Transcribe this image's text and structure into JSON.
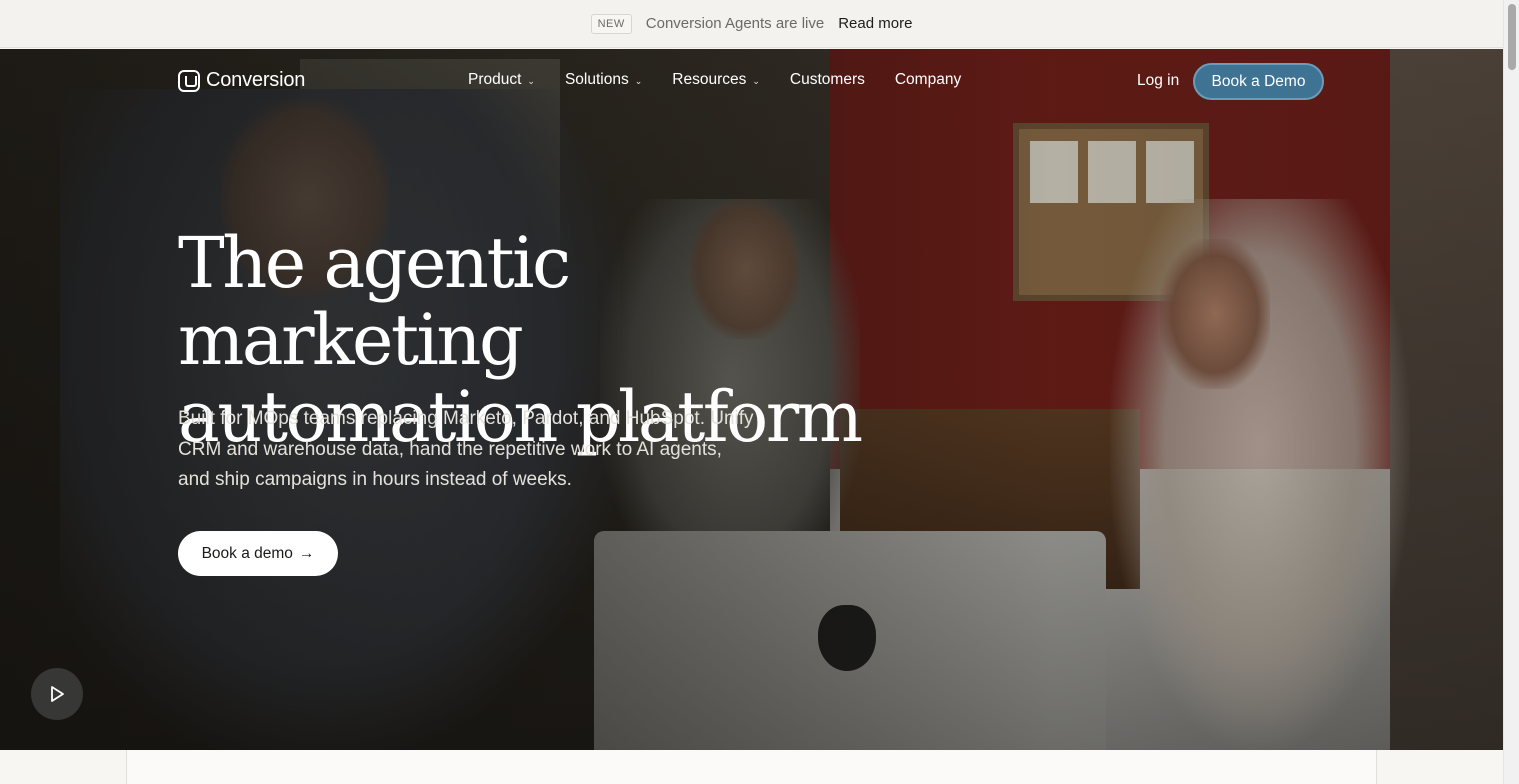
{
  "announcement": {
    "badge": "NEW",
    "message": "Conversion Agents are live",
    "link": "Read more"
  },
  "nav": {
    "logo_text": "Conversion",
    "items": [
      {
        "label": "Product",
        "has_dropdown": true
      },
      {
        "label": "Solutions",
        "has_dropdown": true
      },
      {
        "label": "Resources",
        "has_dropdown": true
      },
      {
        "label": "Customers",
        "has_dropdown": false
      },
      {
        "label": "Company",
        "has_dropdown": false
      }
    ],
    "login": "Log in",
    "cta": "Book a Demo"
  },
  "hero": {
    "headline_line1": "The agentic marketing",
    "headline_line2": "automation platform",
    "subheadline": "Built for MOps teams replacing Marketo, Pardot, and HubSpot. Unify CRM and warehouse data, hand the repetitive work to AI agents, and ship campaigns in hours instead of weeks.",
    "cta_label": "Book a demo",
    "cta_icon": "arrow-right-icon",
    "play_icon": "play-icon"
  },
  "colors": {
    "accent_button": "#3e7393",
    "announcement_bg": "#f3f2ee"
  }
}
